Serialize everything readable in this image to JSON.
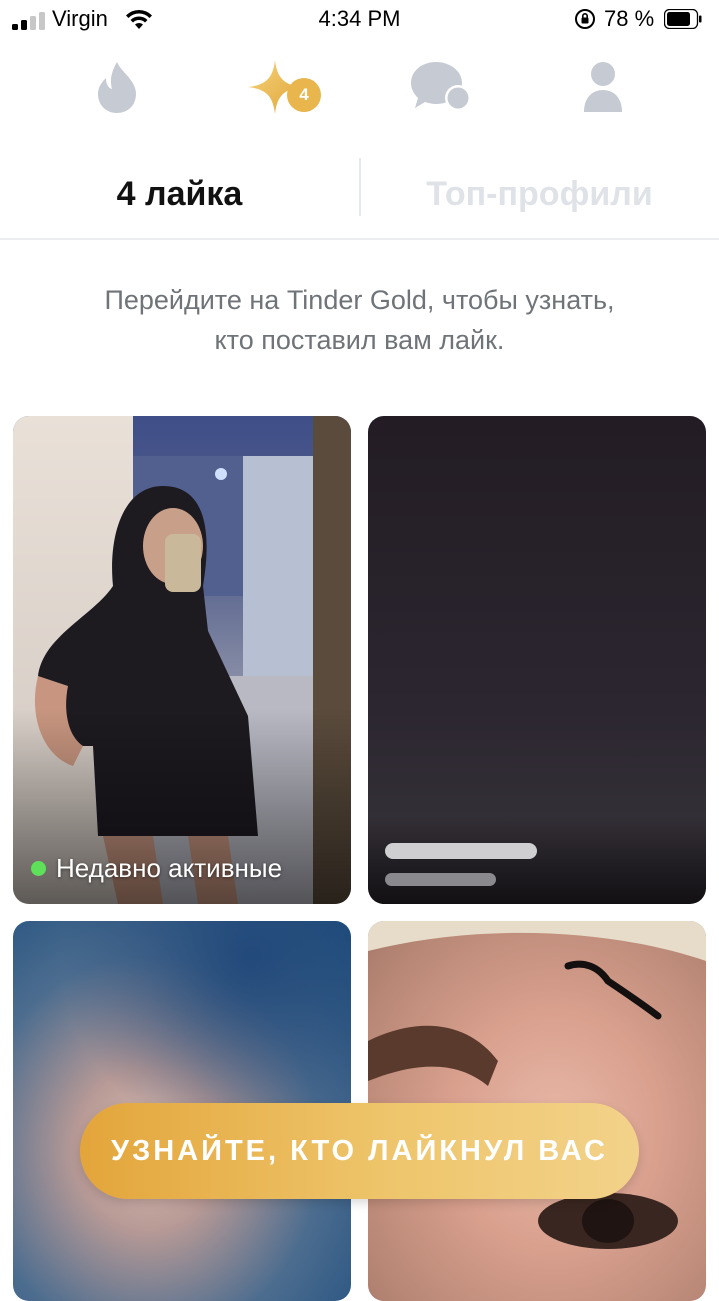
{
  "status_bar": {
    "carrier": "Virgin",
    "time": "4:34 PM",
    "battery_percent": "78 %"
  },
  "nav": {
    "items": [
      {
        "icon": "flame-icon",
        "active": false
      },
      {
        "icon": "gold-star-icon",
        "active": true,
        "badge": "4"
      },
      {
        "icon": "messages-icon",
        "active": false
      },
      {
        "icon": "profile-icon",
        "active": false
      }
    ]
  },
  "tabs": {
    "likes_label": "4 лайка",
    "top_profiles_label": "Топ-профили"
  },
  "promo": {
    "line1": "Перейдите на Tinder Gold, чтобы узнать,",
    "line2": "кто поставил вам лайк."
  },
  "cards": [
    {
      "status_text": "Недавно активные",
      "status_color": "#5fe05b"
    },
    {},
    {},
    {}
  ],
  "cta": {
    "label": "УЗНАЙТЕ, КТО ЛАЙКНУЛ ВАС"
  },
  "colors": {
    "gold": "#e8b64d",
    "inactive_icon": "#c5cad3",
    "inactive_tab": "#dfe3e8",
    "promo_text": "#6f7479"
  }
}
